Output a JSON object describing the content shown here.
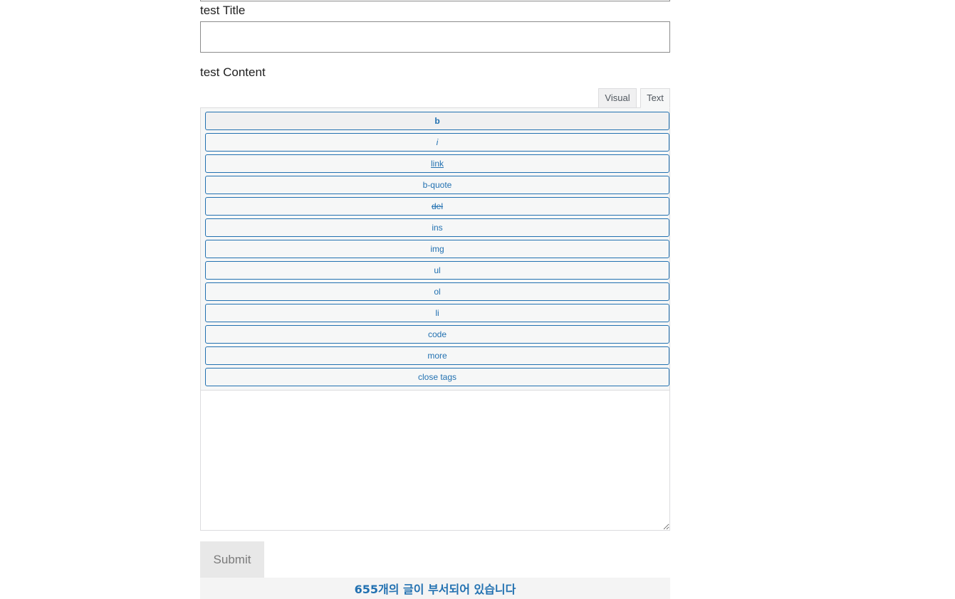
{
  "form": {
    "title_label": "test Title",
    "title_value": "",
    "content_label": "test Content",
    "content_value": "",
    "submit_label": "Submit"
  },
  "editor": {
    "tabs": [
      {
        "label": "Visual",
        "active": false
      },
      {
        "label": "Text",
        "active": true
      }
    ],
    "quicktags": [
      {
        "label": "b"
      },
      {
        "label": "i"
      },
      {
        "label": "link"
      },
      {
        "label": "b-quote"
      },
      {
        "label": "del"
      },
      {
        "label": "ins"
      },
      {
        "label": "img"
      },
      {
        "label": "ul"
      },
      {
        "label": "ol"
      },
      {
        "label": "li"
      },
      {
        "label": "code"
      },
      {
        "label": "more"
      },
      {
        "label": "close tags"
      }
    ]
  },
  "notice": {
    "text": "655개의 글이 부서되어 있습니다"
  },
  "colors": {
    "accent": "#2271b1",
    "toolbar_bg": "#f6f7f7",
    "border": "#dcdcde",
    "submit_bg": "#e8e8e8",
    "submit_text": "#7a7a7a"
  }
}
